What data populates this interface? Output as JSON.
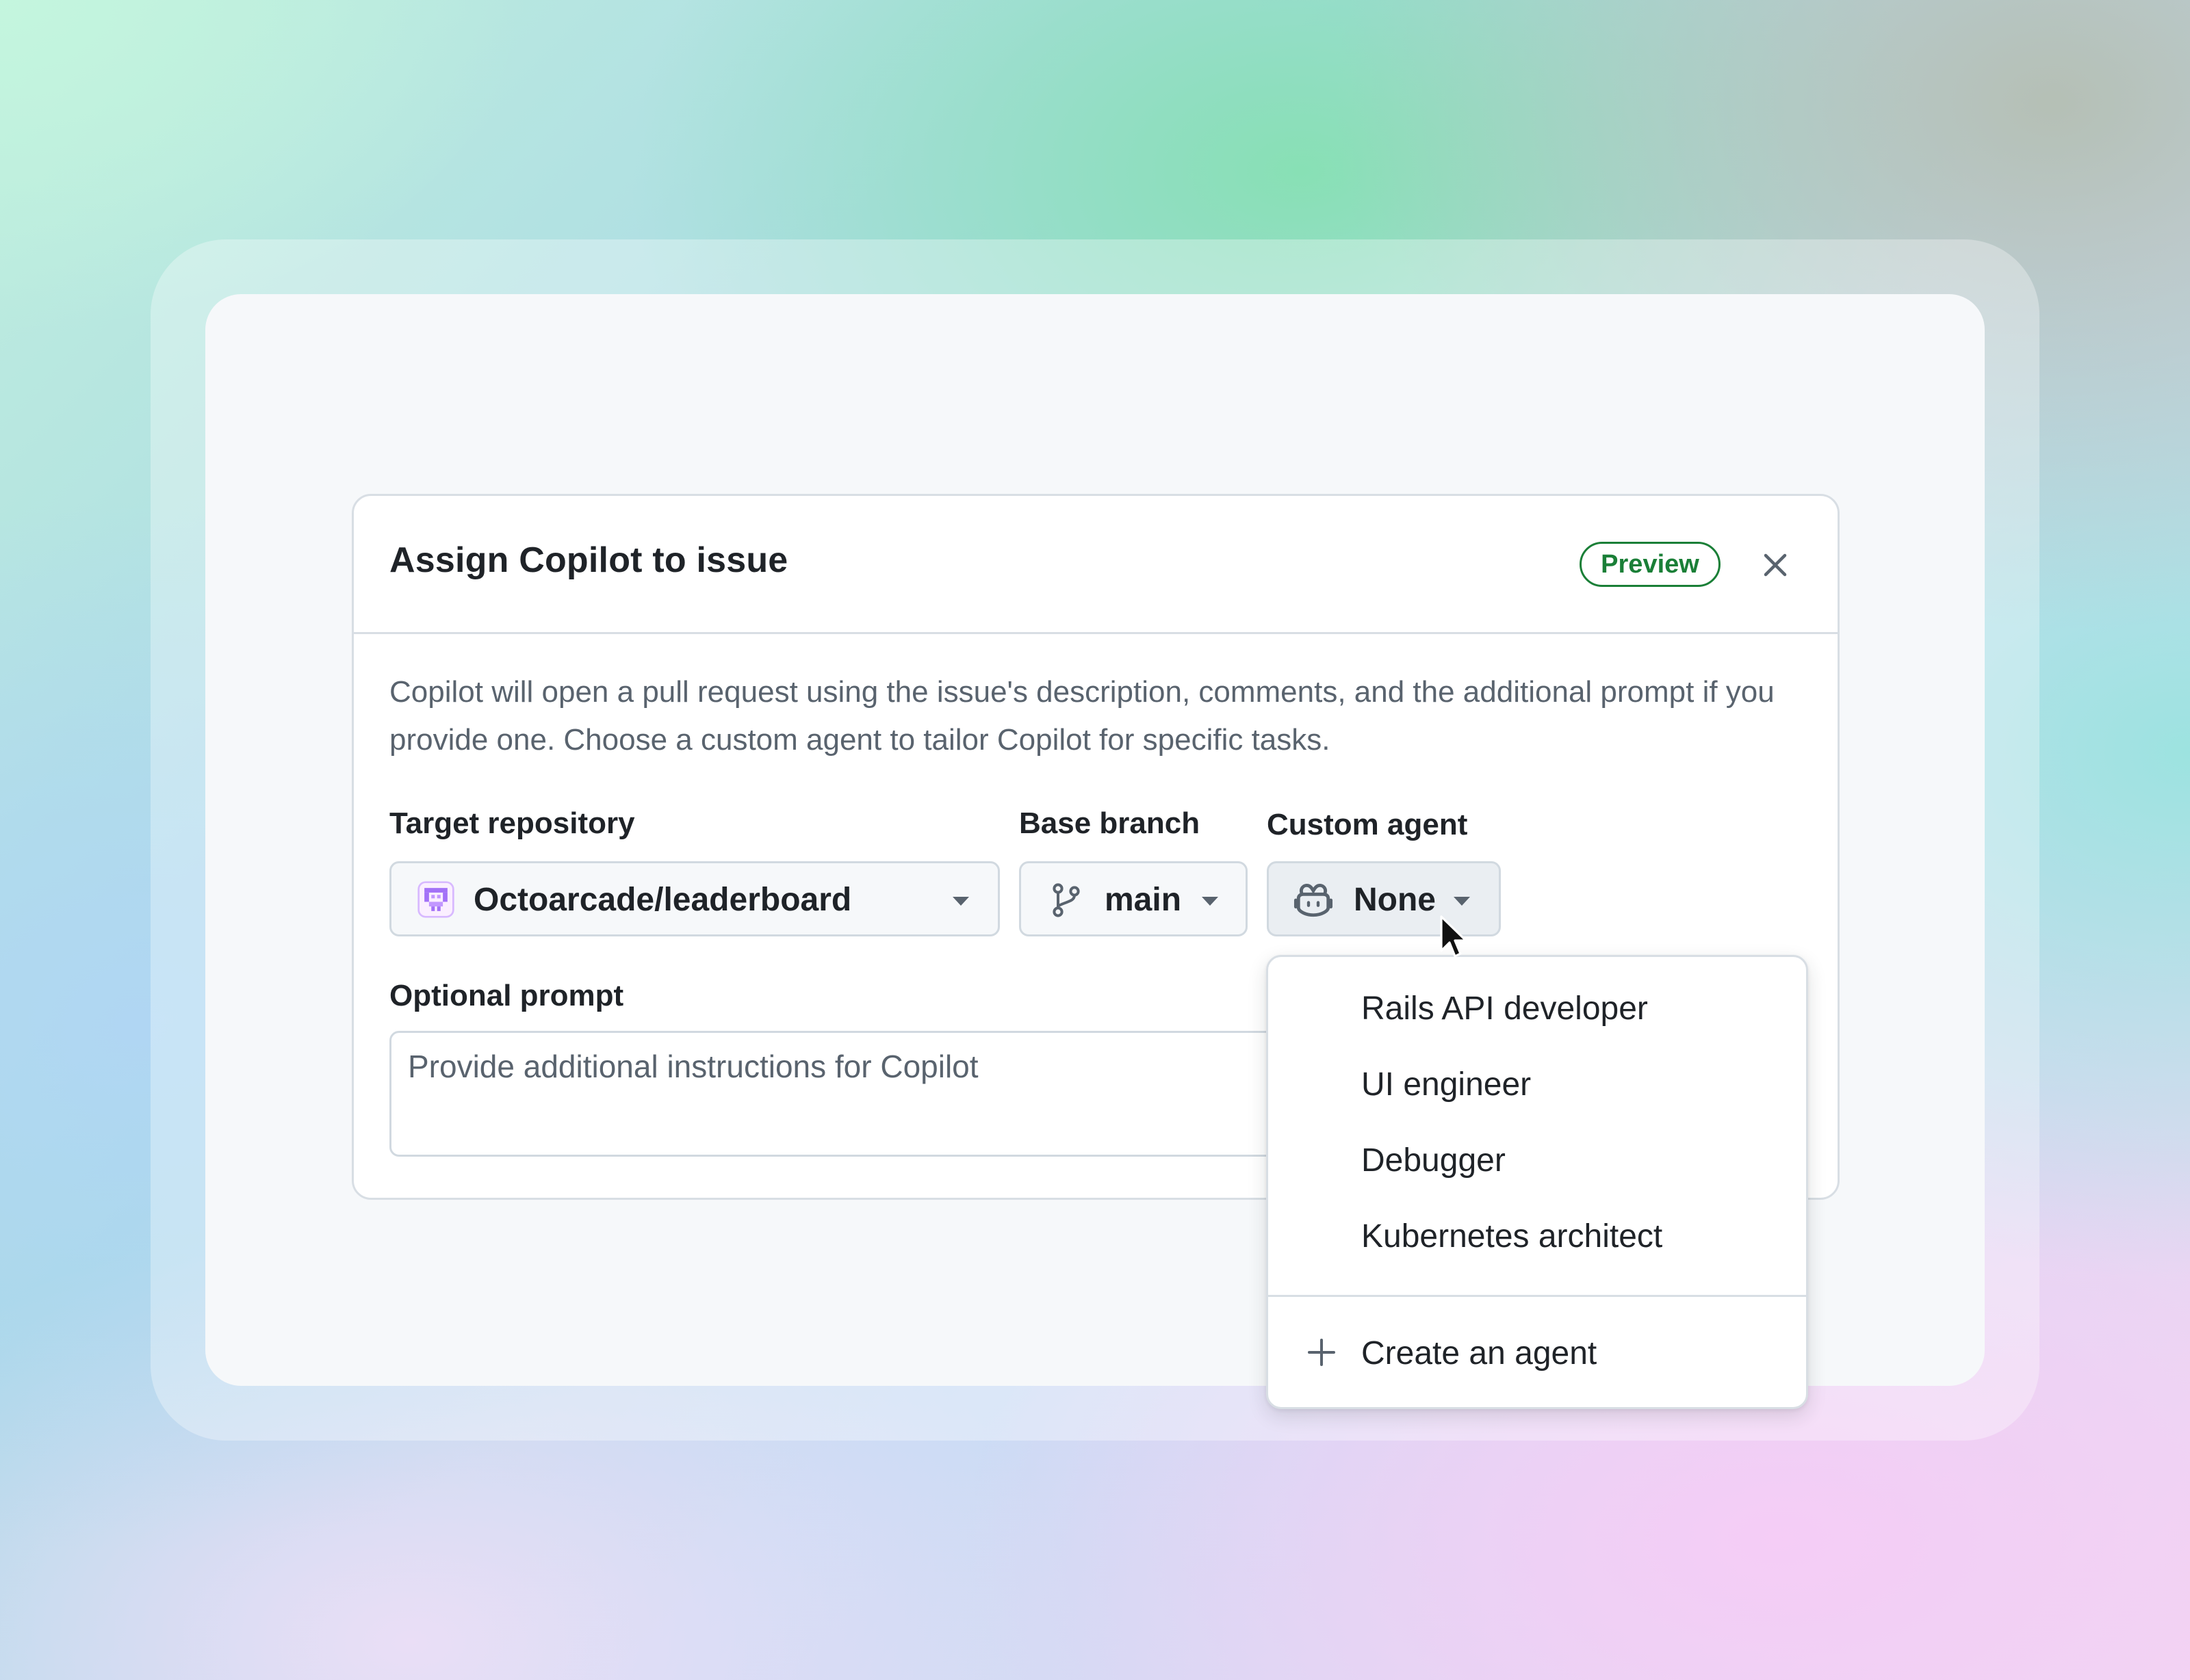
{
  "dialog": {
    "title": "Assign Copilot to issue",
    "badge": "Preview",
    "description": "Copilot will open a pull request using the issue's description, comments, and the additional prompt if you provide one. Choose a custom agent to tailor Copilot for specific tasks."
  },
  "fields": {
    "target_repository": {
      "label": "Target repository",
      "value": "Octoarcade/leaderboard"
    },
    "base_branch": {
      "label": "Base branch",
      "value": "main"
    },
    "custom_agent": {
      "label": "Custom agent",
      "value": "None"
    },
    "optional_prompt": {
      "label": "Optional prompt",
      "placeholder": "Provide additional instructions for Copilot"
    }
  },
  "agent_menu": {
    "items": [
      "Rails API developer",
      "UI engineer",
      "Debugger",
      "Kubernetes architect"
    ],
    "create_label": "Create an agent"
  },
  "icons": {
    "close": "close-icon",
    "repo": "repo-avatar-icon",
    "branch": "git-branch-icon",
    "agent": "copilot-icon",
    "add": "plus-icon"
  },
  "colors": {
    "badge_green": "#1a7f37",
    "avatar_purple": "#a371f7"
  }
}
